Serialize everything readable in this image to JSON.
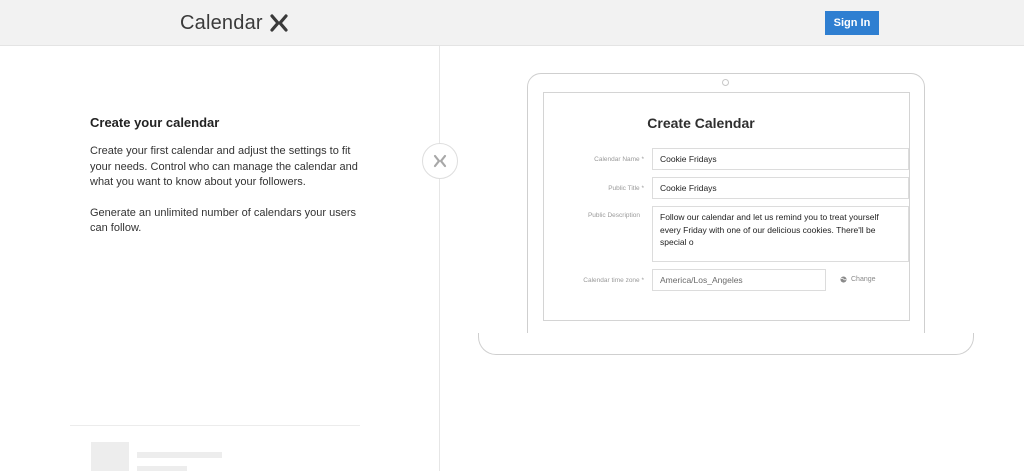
{
  "header": {
    "logo_text": "Calendar",
    "logo_icon": "calendar-x-logo-icon",
    "signin_label": "Sign In",
    "accent_color": "#2f7fd1"
  },
  "intro": {
    "heading": "Create your calendar",
    "paragraph1": "Create your first calendar and adjust the settings to fit your needs. Control who can manage the calendar and what you want to know about your followers.",
    "paragraph2": "Generate an unlimited number of calendars your users can follow."
  },
  "divider": {
    "icon": "x-close-icon"
  },
  "form": {
    "title": "Create Calendar",
    "calendar_name_label": "Calendar Name *",
    "calendar_name_value": "Cookie Fridays",
    "public_title_label": "Public Title *",
    "public_title_value": "Cookie Fridays",
    "public_description_label": "Public Description",
    "public_description_value": "Follow our calendar and let us remind you to treat yourself every Friday with one of our delicious cookies. There'll be special o",
    "timezone_label": "Calendar time zone *",
    "timezone_value": "America/Los_Angeles",
    "change_label": "Change",
    "change_icon": "globe-icon"
  }
}
